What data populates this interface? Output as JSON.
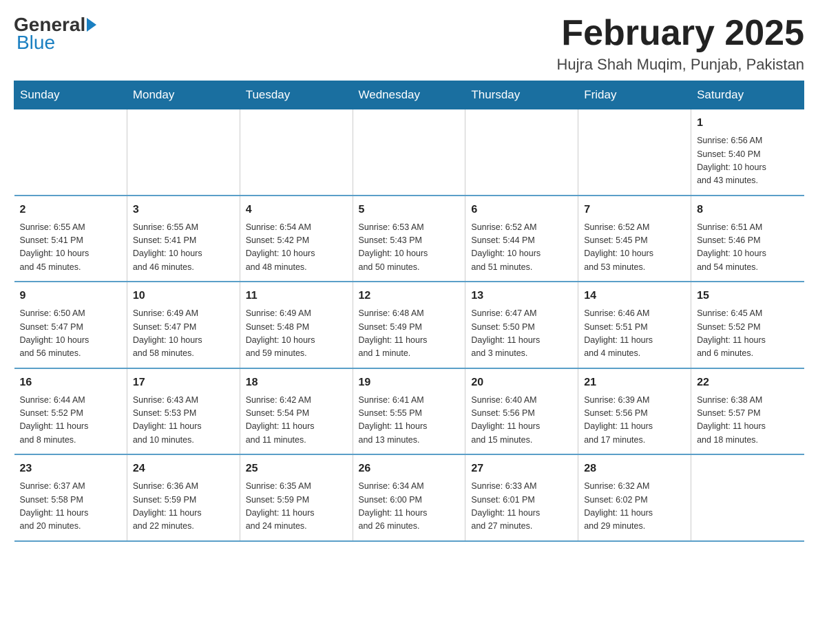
{
  "logo": {
    "general": "General",
    "blue": "Blue"
  },
  "title": "February 2025",
  "location": "Hujra Shah Muqim, Punjab, Pakistan",
  "weekdays": [
    "Sunday",
    "Monday",
    "Tuesday",
    "Wednesday",
    "Thursday",
    "Friday",
    "Saturday"
  ],
  "weeks": [
    [
      {
        "day": "",
        "info": ""
      },
      {
        "day": "",
        "info": ""
      },
      {
        "day": "",
        "info": ""
      },
      {
        "day": "",
        "info": ""
      },
      {
        "day": "",
        "info": ""
      },
      {
        "day": "",
        "info": ""
      },
      {
        "day": "1",
        "info": "Sunrise: 6:56 AM\nSunset: 5:40 PM\nDaylight: 10 hours\nand 43 minutes."
      }
    ],
    [
      {
        "day": "2",
        "info": "Sunrise: 6:55 AM\nSunset: 5:41 PM\nDaylight: 10 hours\nand 45 minutes."
      },
      {
        "day": "3",
        "info": "Sunrise: 6:55 AM\nSunset: 5:41 PM\nDaylight: 10 hours\nand 46 minutes."
      },
      {
        "day": "4",
        "info": "Sunrise: 6:54 AM\nSunset: 5:42 PM\nDaylight: 10 hours\nand 48 minutes."
      },
      {
        "day": "5",
        "info": "Sunrise: 6:53 AM\nSunset: 5:43 PM\nDaylight: 10 hours\nand 50 minutes."
      },
      {
        "day": "6",
        "info": "Sunrise: 6:52 AM\nSunset: 5:44 PM\nDaylight: 10 hours\nand 51 minutes."
      },
      {
        "day": "7",
        "info": "Sunrise: 6:52 AM\nSunset: 5:45 PM\nDaylight: 10 hours\nand 53 minutes."
      },
      {
        "day": "8",
        "info": "Sunrise: 6:51 AM\nSunset: 5:46 PM\nDaylight: 10 hours\nand 54 minutes."
      }
    ],
    [
      {
        "day": "9",
        "info": "Sunrise: 6:50 AM\nSunset: 5:47 PM\nDaylight: 10 hours\nand 56 minutes."
      },
      {
        "day": "10",
        "info": "Sunrise: 6:49 AM\nSunset: 5:47 PM\nDaylight: 10 hours\nand 58 minutes."
      },
      {
        "day": "11",
        "info": "Sunrise: 6:49 AM\nSunset: 5:48 PM\nDaylight: 10 hours\nand 59 minutes."
      },
      {
        "day": "12",
        "info": "Sunrise: 6:48 AM\nSunset: 5:49 PM\nDaylight: 11 hours\nand 1 minute."
      },
      {
        "day": "13",
        "info": "Sunrise: 6:47 AM\nSunset: 5:50 PM\nDaylight: 11 hours\nand 3 minutes."
      },
      {
        "day": "14",
        "info": "Sunrise: 6:46 AM\nSunset: 5:51 PM\nDaylight: 11 hours\nand 4 minutes."
      },
      {
        "day": "15",
        "info": "Sunrise: 6:45 AM\nSunset: 5:52 PM\nDaylight: 11 hours\nand 6 minutes."
      }
    ],
    [
      {
        "day": "16",
        "info": "Sunrise: 6:44 AM\nSunset: 5:52 PM\nDaylight: 11 hours\nand 8 minutes."
      },
      {
        "day": "17",
        "info": "Sunrise: 6:43 AM\nSunset: 5:53 PM\nDaylight: 11 hours\nand 10 minutes."
      },
      {
        "day": "18",
        "info": "Sunrise: 6:42 AM\nSunset: 5:54 PM\nDaylight: 11 hours\nand 11 minutes."
      },
      {
        "day": "19",
        "info": "Sunrise: 6:41 AM\nSunset: 5:55 PM\nDaylight: 11 hours\nand 13 minutes."
      },
      {
        "day": "20",
        "info": "Sunrise: 6:40 AM\nSunset: 5:56 PM\nDaylight: 11 hours\nand 15 minutes."
      },
      {
        "day": "21",
        "info": "Sunrise: 6:39 AM\nSunset: 5:56 PM\nDaylight: 11 hours\nand 17 minutes."
      },
      {
        "day": "22",
        "info": "Sunrise: 6:38 AM\nSunset: 5:57 PM\nDaylight: 11 hours\nand 18 minutes."
      }
    ],
    [
      {
        "day": "23",
        "info": "Sunrise: 6:37 AM\nSunset: 5:58 PM\nDaylight: 11 hours\nand 20 minutes."
      },
      {
        "day": "24",
        "info": "Sunrise: 6:36 AM\nSunset: 5:59 PM\nDaylight: 11 hours\nand 22 minutes."
      },
      {
        "day": "25",
        "info": "Sunrise: 6:35 AM\nSunset: 5:59 PM\nDaylight: 11 hours\nand 24 minutes."
      },
      {
        "day": "26",
        "info": "Sunrise: 6:34 AM\nSunset: 6:00 PM\nDaylight: 11 hours\nand 26 minutes."
      },
      {
        "day": "27",
        "info": "Sunrise: 6:33 AM\nSunset: 6:01 PM\nDaylight: 11 hours\nand 27 minutes."
      },
      {
        "day": "28",
        "info": "Sunrise: 6:32 AM\nSunset: 6:02 PM\nDaylight: 11 hours\nand 29 minutes."
      },
      {
        "day": "",
        "info": ""
      }
    ]
  ]
}
